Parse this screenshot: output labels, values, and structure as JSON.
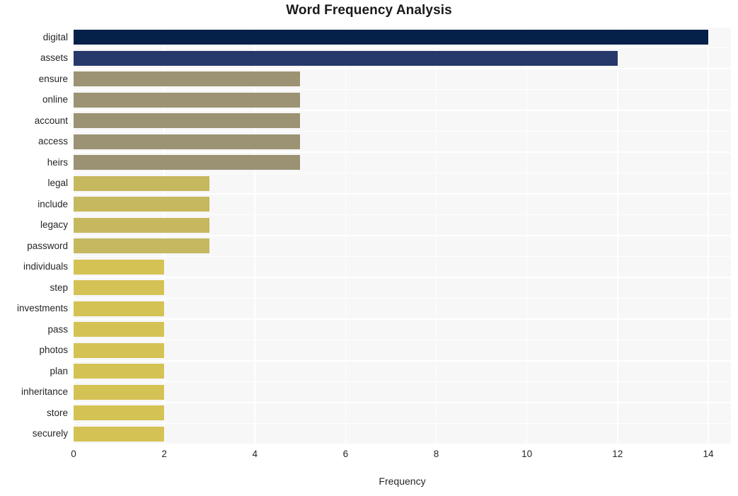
{
  "chart_data": {
    "type": "bar",
    "orientation": "horizontal",
    "title": "Word Frequency Analysis",
    "xlabel": "Frequency",
    "ylabel": "",
    "categories": [
      "digital",
      "assets",
      "ensure",
      "online",
      "account",
      "access",
      "heirs",
      "legal",
      "include",
      "legacy",
      "password",
      "individuals",
      "step",
      "investments",
      "pass",
      "photos",
      "plan",
      "inheritance",
      "store",
      "securely"
    ],
    "values": [
      14,
      12,
      5,
      5,
      5,
      5,
      5,
      3,
      3,
      3,
      3,
      2,
      2,
      2,
      2,
      2,
      2,
      2,
      2,
      2
    ],
    "bar_colors": [
      "#052049",
      "#27396b",
      "#9b9373",
      "#9b9373",
      "#9b9373",
      "#9b9373",
      "#9a9273",
      "#c6b85f",
      "#c6b85f",
      "#c6b85f",
      "#c5b861",
      "#d4c255",
      "#d4c255",
      "#d4c255",
      "#d4c255",
      "#d4c255",
      "#d4c255",
      "#d4c255",
      "#d4c255",
      "#d4c255"
    ],
    "xticks": [
      0,
      2,
      4,
      6,
      8,
      10,
      12,
      14
    ],
    "xtick_labels": [
      "0",
      "2",
      "4",
      "6",
      "8",
      "10",
      "12",
      "14"
    ],
    "xlim": [
      0,
      14.5
    ],
    "ylim_count": 20,
    "grid": true,
    "grid_color": "#ffffff",
    "plot_background": "#f7f7f7",
    "figure_background": "#ffffff",
    "legend": null
  }
}
